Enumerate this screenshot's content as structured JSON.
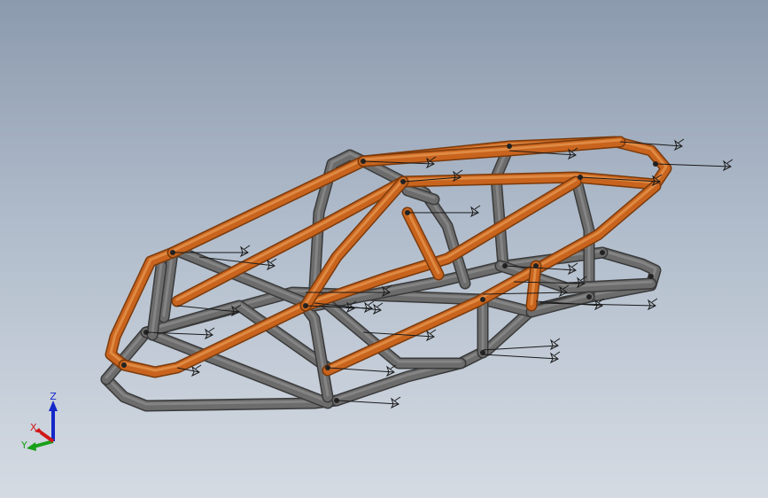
{
  "colors": {
    "bg_top": "#8c9aae",
    "bg_bottom": "#d5dbe3",
    "tube_orange": "#c8641e",
    "tube_orange_dark": "#7a3a0c",
    "tube_grey": "#6c6c6c",
    "tube_grey_dark": "#3a3a3a",
    "axis_x": "#d01818",
    "axis_y": "#18a018",
    "axis_z": "#1428c8"
  },
  "triad": {
    "x_label": "X",
    "y_label": "Y",
    "z_label": "Z"
  },
  "model": {
    "name": "tube-frame-chassis",
    "weld_symbol_count": 26
  }
}
